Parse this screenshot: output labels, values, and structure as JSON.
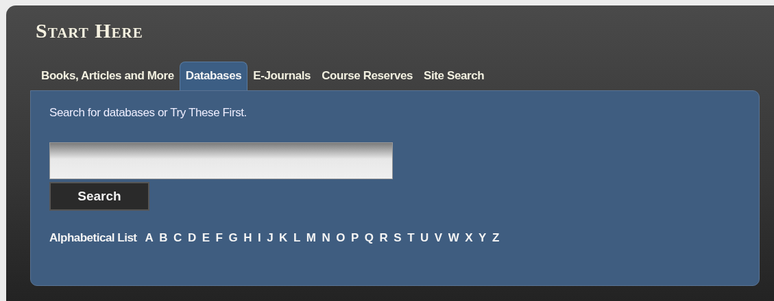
{
  "title": "Start Here",
  "tabs": [
    {
      "label": "Books, Articles and More",
      "selected": false
    },
    {
      "label": "Databases",
      "selected": true
    },
    {
      "label": "E-Journals",
      "selected": false
    },
    {
      "label": "Course Reserves",
      "selected": false
    },
    {
      "label": "Site Search",
      "selected": false
    }
  ],
  "intro": "Search for databases or Try These First.",
  "search_button": "Search",
  "alphabet": {
    "label": "Alphabetical List",
    "letters": [
      "A",
      "B",
      "C",
      "D",
      "E",
      "F",
      "G",
      "H",
      "I",
      "J",
      "K",
      "L",
      "M",
      "N",
      "O",
      "P",
      "Q",
      "R",
      "S",
      "T",
      "U",
      "V",
      "W",
      "X",
      "Y",
      "Z"
    ]
  }
}
